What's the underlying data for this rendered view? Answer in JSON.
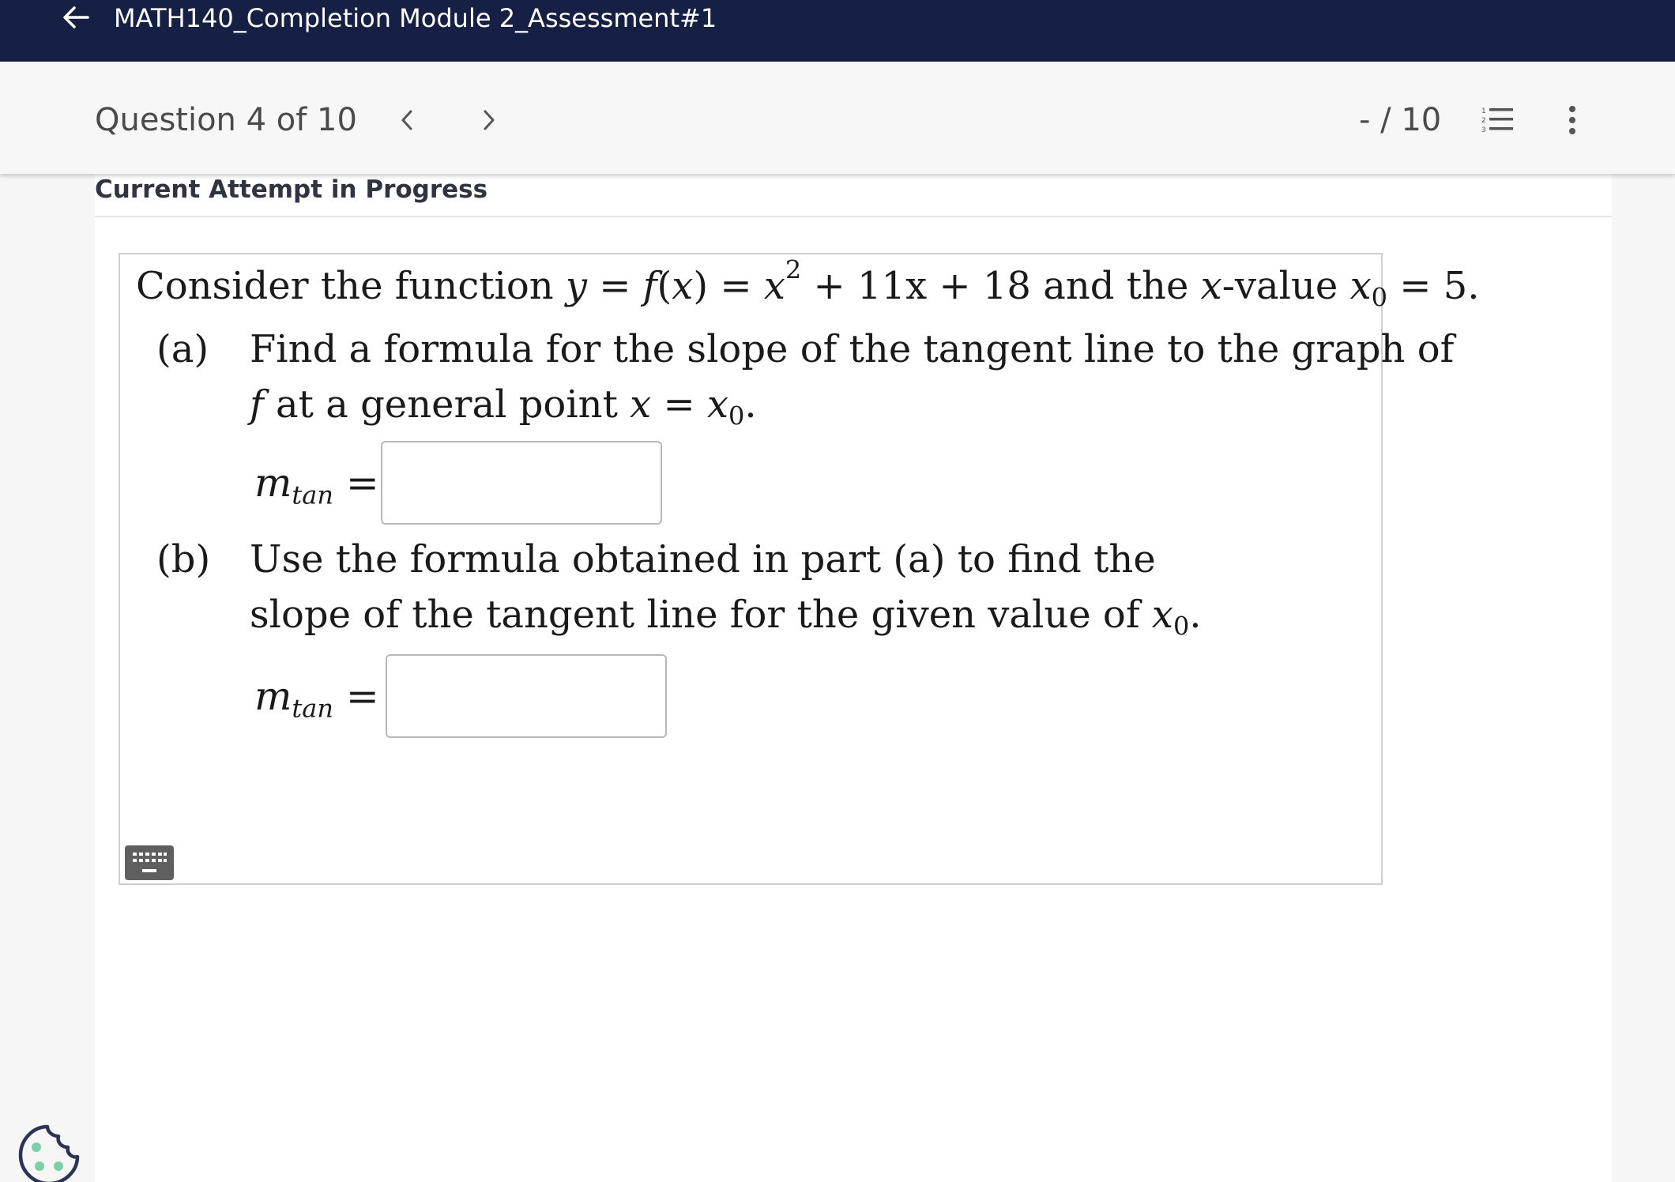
{
  "header": {
    "title": "MATH140_Completion Module 2_Assessment#1",
    "back_icon": "arrow-left-icon"
  },
  "question_bar": {
    "counter": "Question 4 of 10",
    "prev_icon": "chevron-left-icon",
    "next_icon": "chevron-right-icon",
    "score": "- / 10",
    "list_icon": "numbered-list-icon",
    "more_icon": "more-vertical-icon"
  },
  "status": {
    "attempt": "Current Attempt in Progress"
  },
  "question": {
    "intro_prefix": "Consider the function ",
    "intro_mid": " and the ",
    "intro_value_text": "-value ",
    "intro_equals": " = 5.",
    "function_tail": " + 11x + 18",
    "x0_value": "5",
    "part_a": {
      "label": "(a)",
      "line1": "Find a formula for the slope of the tangent line to the graph of",
      "line2_f": "f",
      "line2_text": " at a general point ",
      "answer_label": "m",
      "answer_sub": "tan",
      "answer_value": ""
    },
    "part_b": {
      "label": "(b)",
      "line1": "Use the formula obtained in part (a) to find the",
      "line2": "slope of the tangent line for the given value of ",
      "answer_label": "m",
      "answer_sub": "tan",
      "answer_value": ""
    }
  },
  "tools": {
    "keyboard_icon": "keyboard-icon",
    "cookie_icon": "cookie-icon"
  },
  "colors": {
    "header_bg": "#162044",
    "cookie_dots": "#7ccfa6"
  }
}
